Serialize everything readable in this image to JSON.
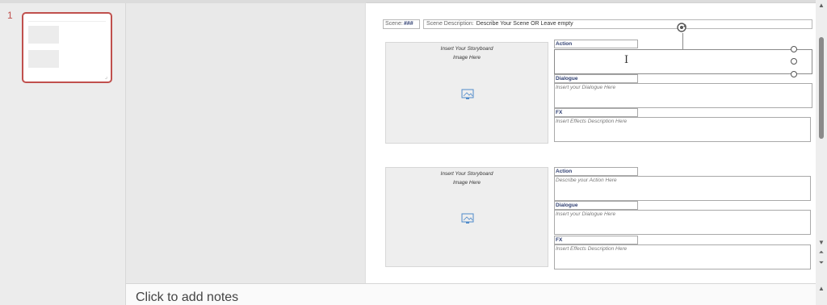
{
  "thumbnails": {
    "slides": [
      {
        "number": "1"
      }
    ]
  },
  "slide": {
    "scene_label": "Scene:",
    "scene_number": "###",
    "scene_description_label": "Scene Description:",
    "scene_description_value": "Describe Your Scene OR Leave empty",
    "panels": [
      {
        "image_placeholder": "Insert Your Storyboard Image Here",
        "image_icon": "picture-icon",
        "action_label": "Action",
        "action_placeholder": "",
        "dialogue_label": "Dialogue",
        "dialogue_placeholder": "Insert your Dialogue Here",
        "fx_label": "FX",
        "fx_placeholder": "Insert Effects Description Here"
      },
      {
        "image_placeholder": "Insert Your Storyboard Image Here",
        "image_icon": "picture-icon",
        "action_label": "Action",
        "action_placeholder": "Describe your Action Here",
        "dialogue_label": "Dialogue",
        "dialogue_placeholder": "Insert your Dialogue Here",
        "fx_label": "FX",
        "fx_placeholder": "Insert Effects Description Here"
      }
    ]
  },
  "notes": {
    "placeholder": "Click to add notes"
  },
  "colors": {
    "accent": "#c0504d",
    "label_text": "#2d3d70"
  }
}
